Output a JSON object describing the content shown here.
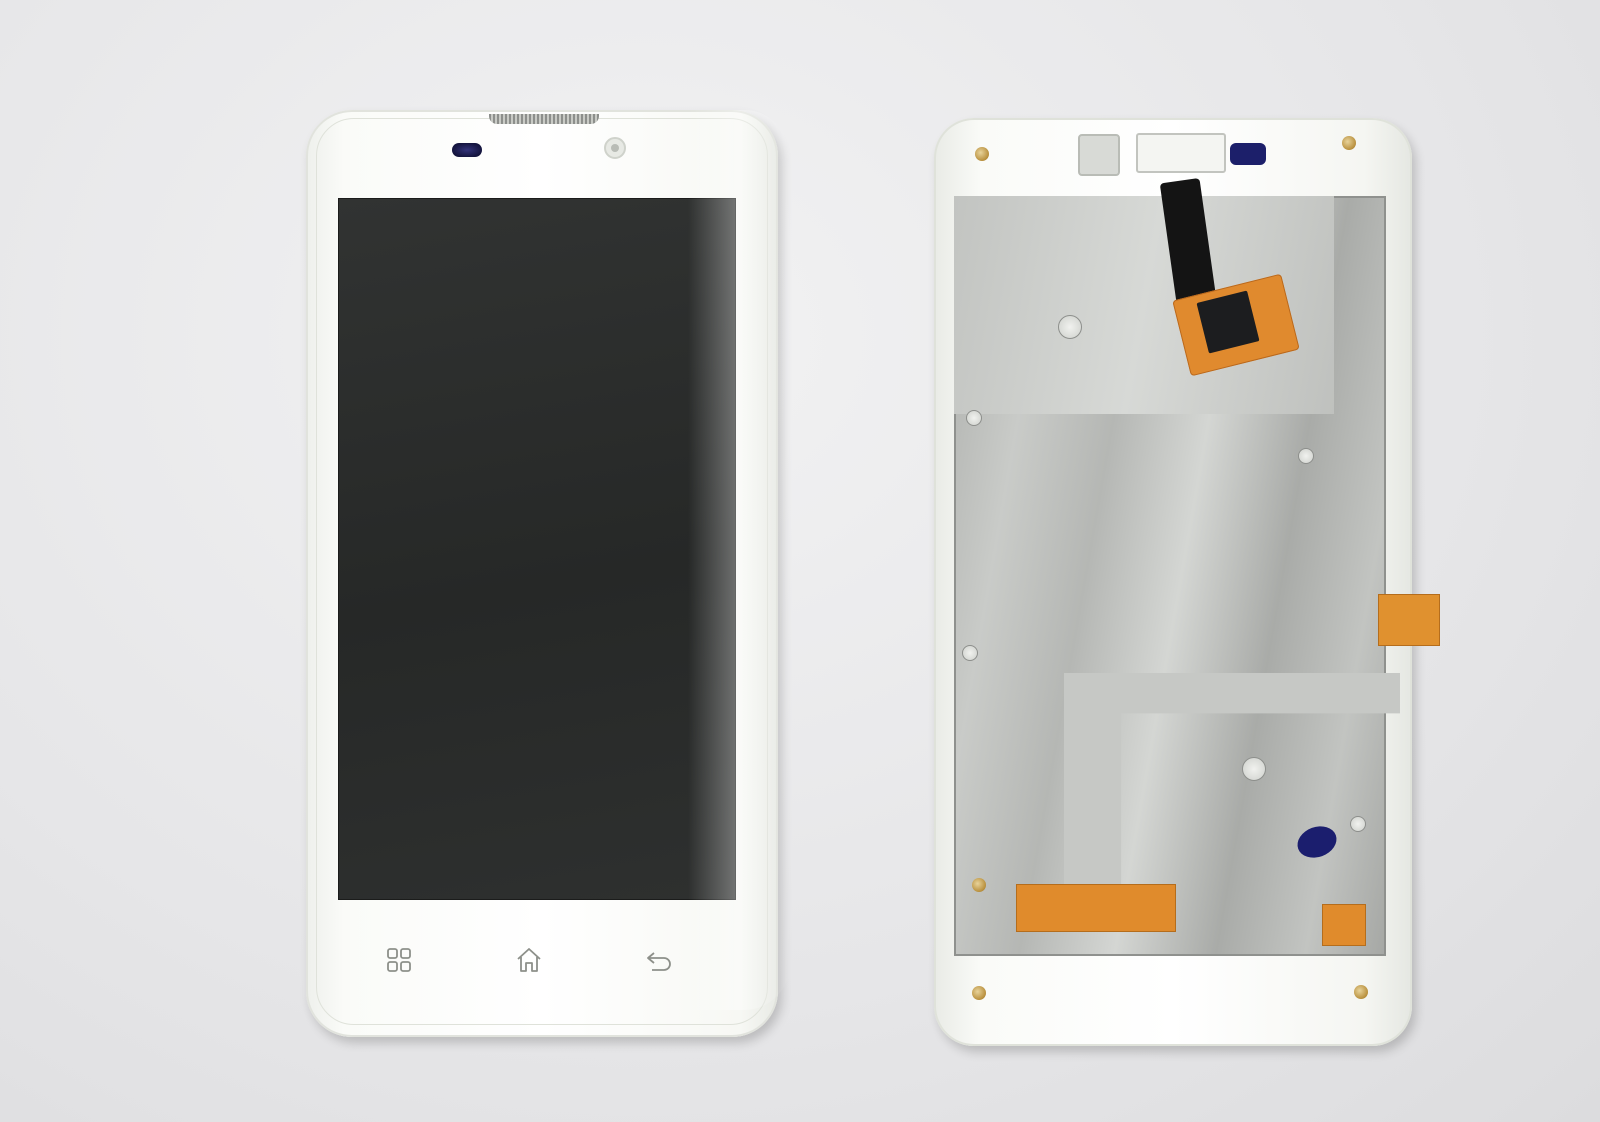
{
  "scene": {
    "front_panel": {
      "navigation_keys": [
        "menu-icon",
        "home-icon",
        "back-icon"
      ]
    },
    "back_panel": {
      "components": [
        "metal-shield",
        "flex-cable",
        "controller-chip",
        "display-connector",
        "mounting-screws"
      ]
    },
    "colors": {
      "background": "#e6e6e8",
      "frame": "#ffffff",
      "screen": "#2b2d2c",
      "shield": "#bcbebb",
      "flex": "#e08a2e",
      "cable": "#141414",
      "accent_blue": "#1b1e6e"
    }
  }
}
